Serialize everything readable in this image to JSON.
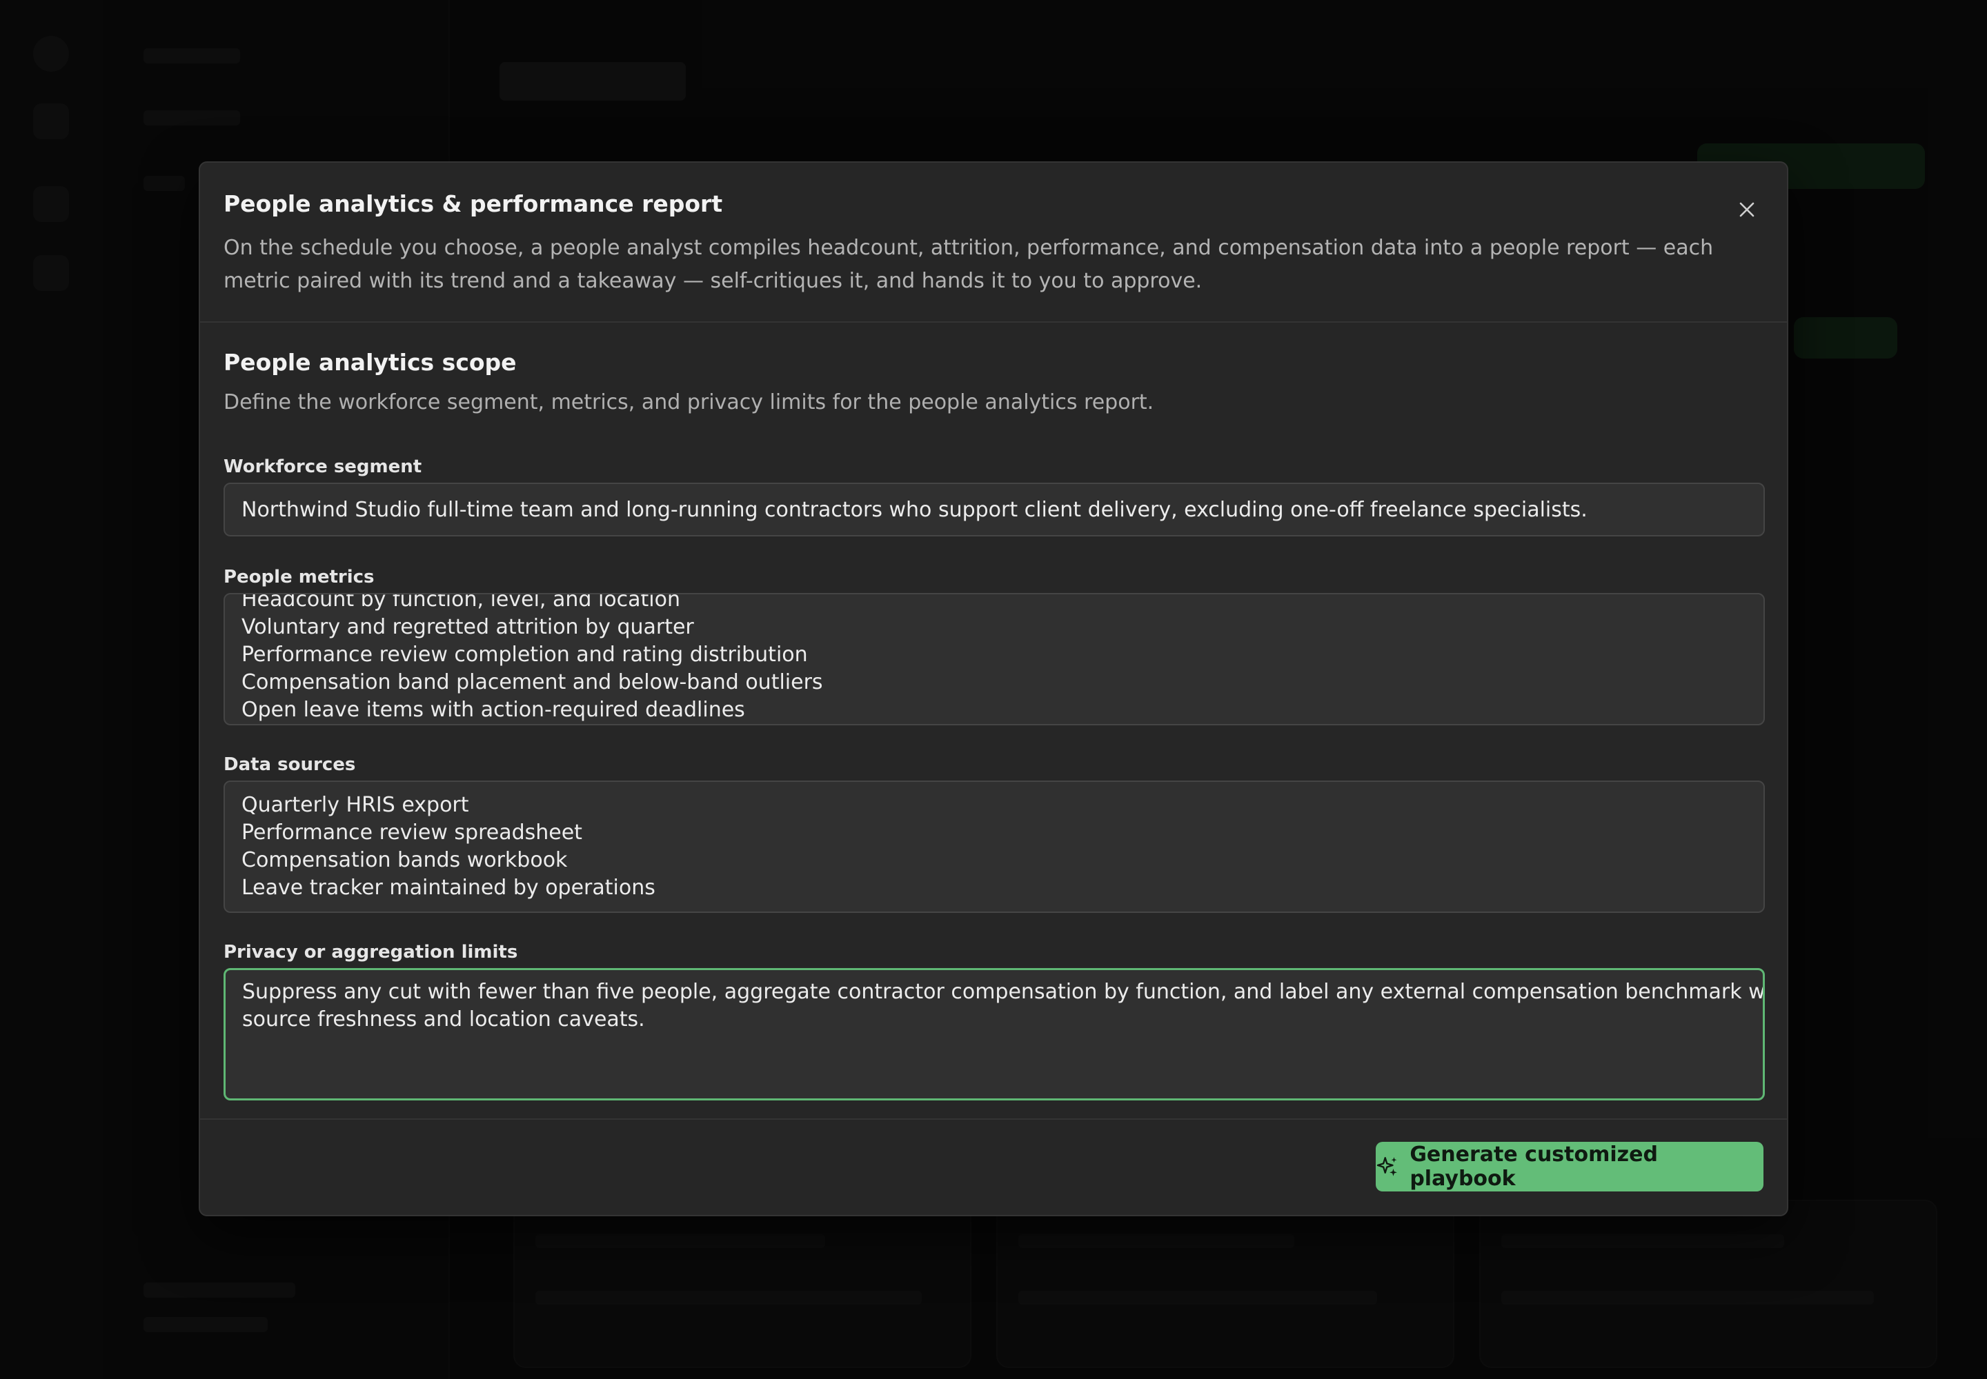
{
  "modal": {
    "title": "People analytics & performance report",
    "description": "On the schedule you choose, a people analyst compiles headcount, attrition, performance, and compensation data into a people report — each metric paired with its trend and a takeaway — self-critiques it, and hands it to you to approve.",
    "close_icon": "close-icon"
  },
  "section": {
    "title": "People analytics scope",
    "description": "Define the workforce segment, metrics, and privacy limits for the people analytics report."
  },
  "fields": {
    "workforce_segment": {
      "label": "Workforce segment",
      "value": "Northwind Studio full-time team and long-running contractors who support client delivery, excluding one-off freelance specialists."
    },
    "people_metrics": {
      "label": "People metrics",
      "lines": [
        "Headcount by function, level, and location",
        "Voluntary and regretted attrition by quarter",
        "Performance review completion and rating distribution",
        "Compensation band placement and below-band outliers",
        "Open leave items with action-required deadlines"
      ]
    },
    "data_sources": {
      "label": "Data sources",
      "lines": [
        "Quarterly HRIS export",
        "Performance review spreadsheet",
        "Compensation bands workbook",
        "Leave tracker maintained by operations"
      ]
    },
    "privacy_limits": {
      "label": "Privacy or aggregation limits",
      "lines": [
        "Suppress any cut with fewer than five people, aggregate contractor compensation by function, and label any external compensation benchmark with",
        "source freshness and location caveats."
      ]
    }
  },
  "footer": {
    "generate_label": "Generate customized playbook",
    "generate_icon": "sparkle-icon"
  },
  "colors": {
    "accent": "#63bd78",
    "focus_border": "#5fb774",
    "modal_bg": "#262626",
    "field_bg": "#303030"
  }
}
